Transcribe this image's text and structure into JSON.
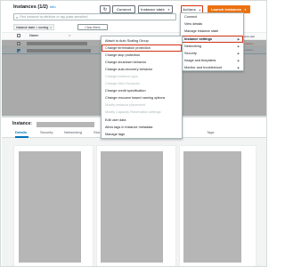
{
  "header": {
    "title": "Instances (1/2)",
    "info": "Info",
    "refresh_icon": "refresh-icon",
    "connect": "Connect",
    "instance_state": "Instance state",
    "actions": "Actions",
    "launch": "Launch instances",
    "search_placeholder": "Find instance by attribute or tag (case-sensitive)",
    "filter_chip": "Instance state = running",
    "clear_filters": "Clear filters"
  },
  "table": {
    "name_col": "Name",
    "right_col_header": "Alarm stat",
    "right_col_values": [
      "No alarms",
      "No alarms"
    ]
  },
  "lower": {
    "title": "Instance:",
    "tabs": [
      "Details",
      "Security",
      "Networking",
      "Stor",
      "Tags"
    ]
  },
  "actions_menu": {
    "items": [
      {
        "label": "Connect"
      },
      {
        "label": "View details"
      },
      {
        "label": "Manage instance state"
      },
      {
        "label": "Instance settings"
      },
      {
        "label": "Networking"
      },
      {
        "label": "Security"
      },
      {
        "label": "Image and templates"
      },
      {
        "label": "Monitor and troubleshoot"
      }
    ]
  },
  "settings_menu": {
    "items": [
      {
        "label": "Attach to Auto Scaling Group",
        "disabled": false
      },
      {
        "label": "Change termination protection",
        "disabled": false
      },
      {
        "label": "Change stop protection",
        "disabled": false
      },
      {
        "label": "Change shutdown behavior",
        "disabled": false
      },
      {
        "label": "Change auto-recovery behavior",
        "disabled": false
      },
      {
        "label": "Change instance type",
        "disabled": true
      },
      {
        "label": "Change Nitro Enclaves",
        "disabled": true
      },
      {
        "label": "Change credit specification",
        "disabled": false
      },
      {
        "label": "Change resource based naming options",
        "disabled": false
      },
      {
        "label": "Modify instance placement",
        "disabled": true
      },
      {
        "label": "Modify Capacity Reservation settings",
        "disabled": true
      },
      {
        "label": "Edit user data",
        "disabled": false
      },
      {
        "label": "Allow tags in instance metadata",
        "disabled": false
      },
      {
        "label": "Manage tags",
        "disabled": false
      }
    ]
  },
  "colors": {
    "accent": "#ec7211",
    "link": "#0073bb",
    "highlight_border": "#d13212"
  }
}
